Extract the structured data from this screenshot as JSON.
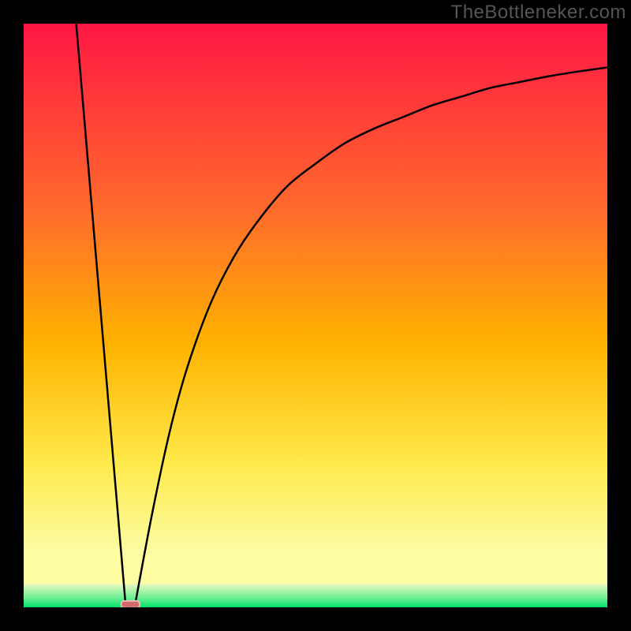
{
  "watermark": "TheBottleneker.com",
  "chart_data": {
    "type": "line",
    "title": "",
    "xlabel": "",
    "ylabel": "",
    "xlim": [
      0,
      100
    ],
    "ylim": [
      0,
      100
    ],
    "grid": false,
    "legend": false,
    "background_gradient": [
      "#FF1744",
      "#FF5722",
      "#FFC107",
      "#FFEB3B",
      "#FFF59D",
      "#00E676"
    ],
    "series": [
      {
        "name": "descending-segment",
        "x": [
          9,
          17.5
        ],
        "y": [
          100,
          0
        ]
      },
      {
        "name": "rising-curve",
        "x": [
          19,
          22,
          25,
          28,
          32,
          36,
          40,
          45,
          50,
          55,
          60,
          65,
          70,
          75,
          80,
          85,
          90,
          95,
          100
        ],
        "y": [
          0,
          16,
          30,
          41,
          52,
          60,
          66,
          72,
          76,
          79.5,
          82,
          84,
          86,
          87.5,
          89,
          90,
          91,
          91.8,
          92.5
        ]
      }
    ],
    "marker": {
      "name": "minimum-marker",
      "x": 18.3,
      "y": 0.5,
      "width": 3.2,
      "height": 1.2,
      "fill": "#D16A6A",
      "stroke": "#F0B8B8"
    },
    "green_band_top": 4
  }
}
